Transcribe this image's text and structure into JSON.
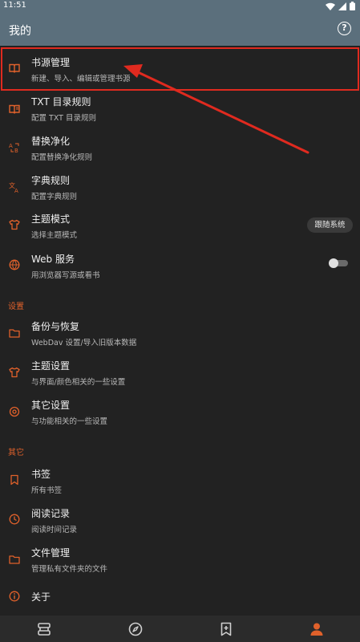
{
  "status": {
    "time": "11:51"
  },
  "appbar": {
    "title": "我的",
    "help_icon": "help-circle-icon"
  },
  "menu": [
    {
      "title": "书源管理",
      "sub": "新建、导入、编辑或管理书源",
      "icon": "book-source-icon"
    },
    {
      "title": "TXT 目录规则",
      "sub": "配置 TXT 目录规则",
      "icon": "txt-rule-icon"
    },
    {
      "title": "替换净化",
      "sub": "配置替换净化规则",
      "icon": "replace-icon"
    },
    {
      "title": "字典规则",
      "sub": "配置字典规则",
      "icon": "translate-icon"
    },
    {
      "title": "主题模式",
      "sub": "选择主题模式",
      "icon": "shirt-icon",
      "value": "跟随系统"
    },
    {
      "title": "Web 服务",
      "sub": "用浏览器写源或看书",
      "icon": "globe-icon"
    }
  ],
  "settings_section": "设置",
  "settings": [
    {
      "title": "备份与恢复",
      "sub": "WebDav 设置/导入旧版本数据",
      "icon": "folder-icon"
    },
    {
      "title": "主题设置",
      "sub": "与界面/颜色相关的一些设置",
      "icon": "shirt-icon"
    },
    {
      "title": "其它设置",
      "sub": "与功能相关的一些设置",
      "icon": "gear-icon"
    }
  ],
  "other_section": "其它",
  "other": [
    {
      "title": "书签",
      "sub": "所有书签",
      "icon": "bookmark-icon"
    },
    {
      "title": "阅读记录",
      "sub": "阅读时间记录",
      "icon": "clock-icon"
    },
    {
      "title": "文件管理",
      "sub": "管理私有文件夹的文件",
      "icon": "folder-icon"
    },
    {
      "title": "关于",
      "icon": "info-icon"
    }
  ],
  "colors": {
    "accent": "#e0612b",
    "appbar": "#5b6f7c",
    "background": "#222222",
    "highlight": "#e02a1f"
  }
}
